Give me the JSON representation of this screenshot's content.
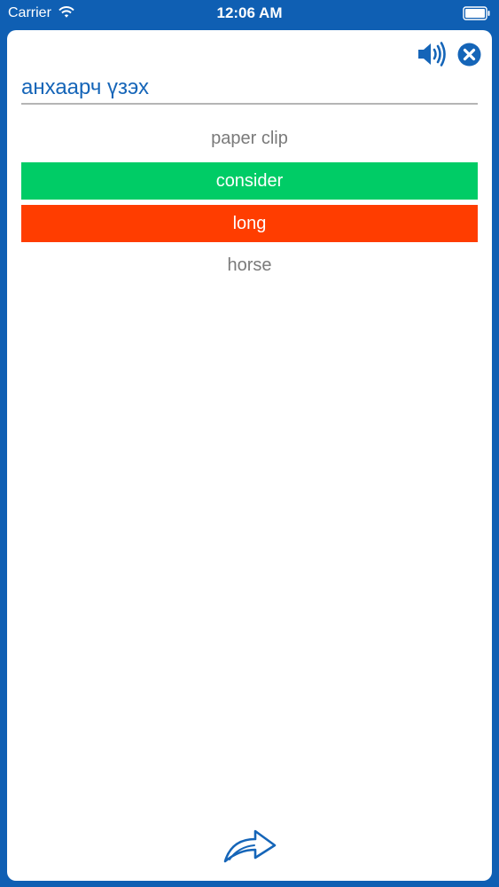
{
  "status_bar": {
    "carrier": "Carrier",
    "time": "12:06 AM",
    "wifi_icon": "wifi-icon",
    "battery_icon": "battery-icon"
  },
  "quiz": {
    "question_word": "анхаарч үзэх",
    "options": [
      {
        "label": "paper clip",
        "state": "default"
      },
      {
        "label": "consider",
        "state": "correct"
      },
      {
        "label": "long",
        "state": "wrong"
      },
      {
        "label": "horse",
        "state": "default"
      }
    ],
    "speaker_icon": "speaker-icon",
    "close_icon": "close-icon",
    "next_icon": "next-arrow-icon"
  },
  "colors": {
    "background": "#0f5fb3",
    "accent": "#1565b8",
    "correct": "#00cc66",
    "wrong": "#ff3d00"
  }
}
